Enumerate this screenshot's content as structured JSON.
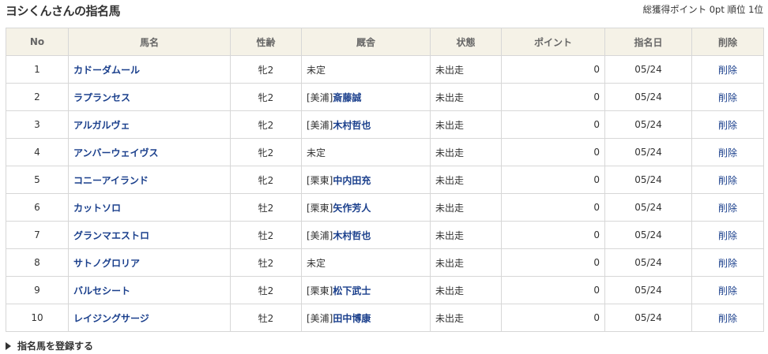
{
  "header": {
    "title": "ヨシくんさんの指名馬",
    "summary": "総獲得ポイント 0pt 順位 1位"
  },
  "table": {
    "columns": [
      "No",
      "馬名",
      "性齢",
      "厩舎",
      "状態",
      "ポイント",
      "指名日",
      "削除"
    ],
    "rows": [
      {
        "no": "1",
        "name": "カドーダムール",
        "sex": "牝2",
        "region": "",
        "trainer": "",
        "stable_text": "未定",
        "status": "未出走",
        "points": "0",
        "date": "05/24",
        "delete": "削除"
      },
      {
        "no": "2",
        "name": "ラプランセス",
        "sex": "牝2",
        "region": "[美浦]",
        "trainer": "斎藤誠",
        "stable_text": "",
        "status": "未出走",
        "points": "0",
        "date": "05/24",
        "delete": "削除"
      },
      {
        "no": "3",
        "name": "アルガルヴェ",
        "sex": "牝2",
        "region": "[美浦]",
        "trainer": "木村哲也",
        "stable_text": "",
        "status": "未出走",
        "points": "0",
        "date": "05/24",
        "delete": "削除"
      },
      {
        "no": "4",
        "name": "アンバーウェイヴス",
        "sex": "牝2",
        "region": "",
        "trainer": "",
        "stable_text": "未定",
        "status": "未出走",
        "points": "0",
        "date": "05/24",
        "delete": "削除"
      },
      {
        "no": "5",
        "name": "コニーアイランド",
        "sex": "牝2",
        "region": "[栗東]",
        "trainer": "中内田充",
        "stable_text": "",
        "status": "未出走",
        "points": "0",
        "date": "05/24",
        "delete": "削除"
      },
      {
        "no": "6",
        "name": "カットソロ",
        "sex": "牡2",
        "region": "[栗東]",
        "trainer": "矢作芳人",
        "stable_text": "",
        "status": "未出走",
        "points": "0",
        "date": "05/24",
        "delete": "削除"
      },
      {
        "no": "7",
        "name": "グランマエストロ",
        "sex": "牡2",
        "region": "[美浦]",
        "trainer": "木村哲也",
        "stable_text": "",
        "status": "未出走",
        "points": "0",
        "date": "05/24",
        "delete": "削除"
      },
      {
        "no": "8",
        "name": "サトノグロリア",
        "sex": "牡2",
        "region": "",
        "trainer": "",
        "stable_text": "未定",
        "status": "未出走",
        "points": "0",
        "date": "05/24",
        "delete": "削除"
      },
      {
        "no": "9",
        "name": "バルセシート",
        "sex": "牡2",
        "region": "[栗東]",
        "trainer": "松下武士",
        "stable_text": "",
        "status": "未出走",
        "points": "0",
        "date": "05/24",
        "delete": "削除"
      },
      {
        "no": "10",
        "name": "レイジングサージ",
        "sex": "牡2",
        "region": "[美浦]",
        "trainer": "田中博康",
        "stable_text": "",
        "status": "未出走",
        "points": "0",
        "date": "05/24",
        "delete": "削除"
      }
    ]
  },
  "footer": {
    "register_label": "指名馬を登録する",
    "register_icon": "triangle-right-icon"
  },
  "colors": {
    "header_bg": "#f5f2e7",
    "link": "#1a3f8c",
    "border": "#d7d7d7"
  }
}
